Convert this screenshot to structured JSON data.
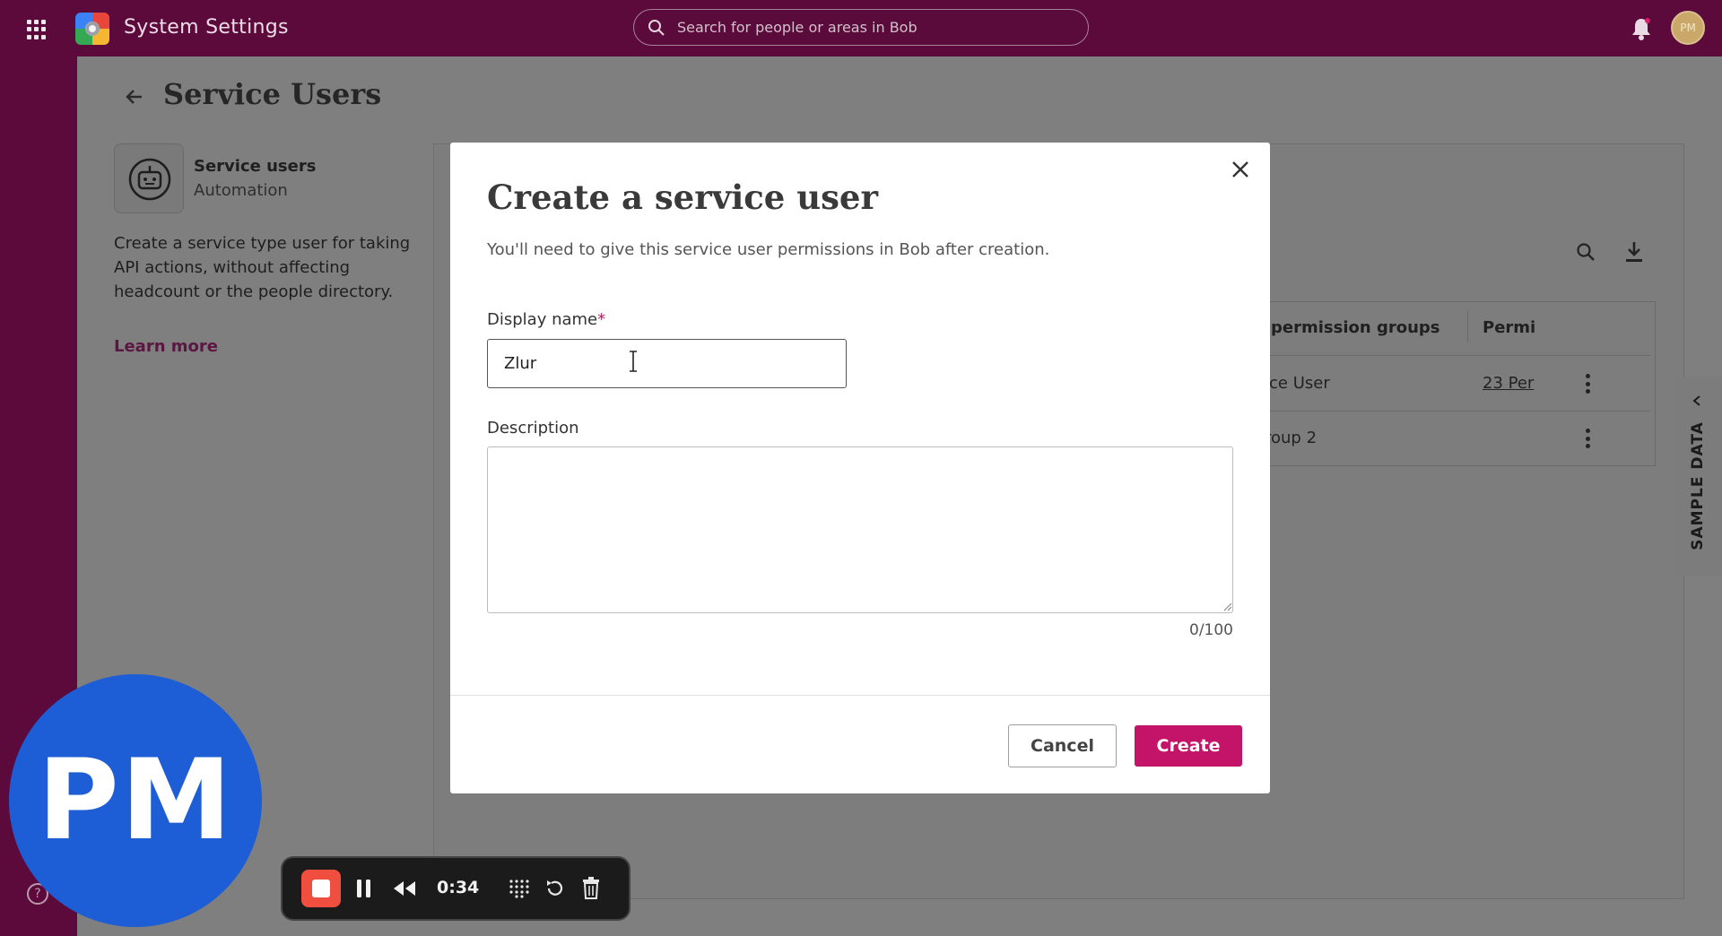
{
  "topbar": {
    "app_title": "System Settings",
    "search_placeholder": "Search for people or areas in Bob",
    "avatar_initials": "PM"
  },
  "page": {
    "title": "Service Users"
  },
  "sidebar": {
    "card_title": "Service users",
    "card_subtitle": "Automation",
    "description": "Create a service type user for taking API actions, without affecting headcount or the people directory.",
    "learn_more": "Learn more"
  },
  "table": {
    "headers": [
      "permission groups",
      "Permi"
    ],
    "rows": [
      {
        "group": "ice User",
        "permissions": "23 Per"
      },
      {
        "group": "roup 2",
        "permissions": ""
      }
    ]
  },
  "sample_tab": {
    "label": "SAMPLE DATA"
  },
  "modal": {
    "title": "Create a service user",
    "subtitle": "You'll need to give this service user permissions in Bob after creation.",
    "display_name_label": "Display name",
    "required_mark": "*",
    "display_name_value": "Zlur",
    "description_label": "Description",
    "description_value": "",
    "counter": "0/100",
    "cancel_label": "Cancel",
    "create_label": "Create"
  },
  "overlay": {
    "avatar_initials": "PM",
    "help_glyph": "?"
  },
  "recorder": {
    "timer": "0:34"
  },
  "colors": {
    "topbar": "#5c0a3c",
    "primary_button": "#c4146a",
    "avatar_circle": "#1d5dd6",
    "record_button": "#f04e3e"
  }
}
